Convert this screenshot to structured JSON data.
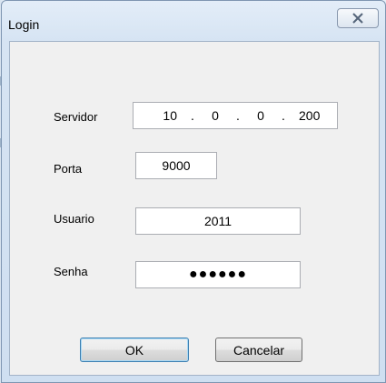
{
  "dialog": {
    "title": "Login",
    "close_glyph": "☒"
  },
  "form": {
    "servidor": {
      "label": "Servidor",
      "octet1": "10",
      "octet2": "0",
      "octet3": "0",
      "octet4": "200",
      "separator": "."
    },
    "porta": {
      "label": "Porta",
      "value": "9000"
    },
    "usuario": {
      "label": "Usuario",
      "value": "2011"
    },
    "senha": {
      "label": "Senha",
      "masked_value": "●●●●●●"
    }
  },
  "buttons": {
    "ok_label": "OK",
    "cancel_label": "Cancelar"
  },
  "icons": {
    "close": "close-icon"
  }
}
